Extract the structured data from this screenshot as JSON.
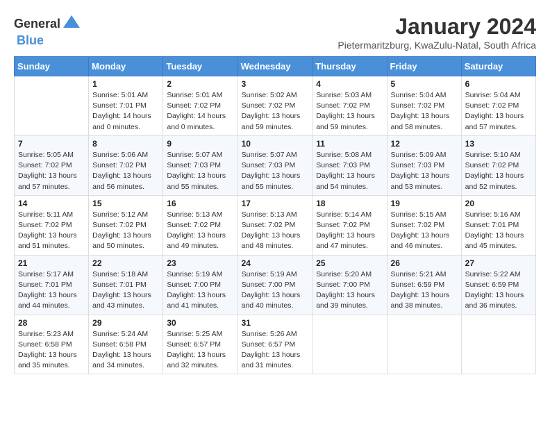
{
  "header": {
    "logo_general": "General",
    "logo_blue": "Blue",
    "month_title": "January 2024",
    "location": "Pietermaritzburg, KwaZulu-Natal, South Africa"
  },
  "days_of_week": [
    "Sunday",
    "Monday",
    "Tuesday",
    "Wednesday",
    "Thursday",
    "Friday",
    "Saturday"
  ],
  "weeks": [
    [
      {
        "day": "",
        "info": ""
      },
      {
        "day": "1",
        "info": "Sunrise: 5:01 AM\nSunset: 7:01 PM\nDaylight: 14 hours\nand 0 minutes."
      },
      {
        "day": "2",
        "info": "Sunrise: 5:01 AM\nSunset: 7:02 PM\nDaylight: 14 hours\nand 0 minutes."
      },
      {
        "day": "3",
        "info": "Sunrise: 5:02 AM\nSunset: 7:02 PM\nDaylight: 13 hours\nand 59 minutes."
      },
      {
        "day": "4",
        "info": "Sunrise: 5:03 AM\nSunset: 7:02 PM\nDaylight: 13 hours\nand 59 minutes."
      },
      {
        "day": "5",
        "info": "Sunrise: 5:04 AM\nSunset: 7:02 PM\nDaylight: 13 hours\nand 58 minutes."
      },
      {
        "day": "6",
        "info": "Sunrise: 5:04 AM\nSunset: 7:02 PM\nDaylight: 13 hours\nand 57 minutes."
      }
    ],
    [
      {
        "day": "7",
        "info": "Sunrise: 5:05 AM\nSunset: 7:02 PM\nDaylight: 13 hours\nand 57 minutes."
      },
      {
        "day": "8",
        "info": "Sunrise: 5:06 AM\nSunset: 7:02 PM\nDaylight: 13 hours\nand 56 minutes."
      },
      {
        "day": "9",
        "info": "Sunrise: 5:07 AM\nSunset: 7:03 PM\nDaylight: 13 hours\nand 55 minutes."
      },
      {
        "day": "10",
        "info": "Sunrise: 5:07 AM\nSunset: 7:03 PM\nDaylight: 13 hours\nand 55 minutes."
      },
      {
        "day": "11",
        "info": "Sunrise: 5:08 AM\nSunset: 7:03 PM\nDaylight: 13 hours\nand 54 minutes."
      },
      {
        "day": "12",
        "info": "Sunrise: 5:09 AM\nSunset: 7:03 PM\nDaylight: 13 hours\nand 53 minutes."
      },
      {
        "day": "13",
        "info": "Sunrise: 5:10 AM\nSunset: 7:02 PM\nDaylight: 13 hours\nand 52 minutes."
      }
    ],
    [
      {
        "day": "14",
        "info": "Sunrise: 5:11 AM\nSunset: 7:02 PM\nDaylight: 13 hours\nand 51 minutes."
      },
      {
        "day": "15",
        "info": "Sunrise: 5:12 AM\nSunset: 7:02 PM\nDaylight: 13 hours\nand 50 minutes."
      },
      {
        "day": "16",
        "info": "Sunrise: 5:13 AM\nSunset: 7:02 PM\nDaylight: 13 hours\nand 49 minutes."
      },
      {
        "day": "17",
        "info": "Sunrise: 5:13 AM\nSunset: 7:02 PM\nDaylight: 13 hours\nand 48 minutes."
      },
      {
        "day": "18",
        "info": "Sunrise: 5:14 AM\nSunset: 7:02 PM\nDaylight: 13 hours\nand 47 minutes."
      },
      {
        "day": "19",
        "info": "Sunrise: 5:15 AM\nSunset: 7:02 PM\nDaylight: 13 hours\nand 46 minutes."
      },
      {
        "day": "20",
        "info": "Sunrise: 5:16 AM\nSunset: 7:01 PM\nDaylight: 13 hours\nand 45 minutes."
      }
    ],
    [
      {
        "day": "21",
        "info": "Sunrise: 5:17 AM\nSunset: 7:01 PM\nDaylight: 13 hours\nand 44 minutes."
      },
      {
        "day": "22",
        "info": "Sunrise: 5:18 AM\nSunset: 7:01 PM\nDaylight: 13 hours\nand 43 minutes."
      },
      {
        "day": "23",
        "info": "Sunrise: 5:19 AM\nSunset: 7:00 PM\nDaylight: 13 hours\nand 41 minutes."
      },
      {
        "day": "24",
        "info": "Sunrise: 5:19 AM\nSunset: 7:00 PM\nDaylight: 13 hours\nand 40 minutes."
      },
      {
        "day": "25",
        "info": "Sunrise: 5:20 AM\nSunset: 7:00 PM\nDaylight: 13 hours\nand 39 minutes."
      },
      {
        "day": "26",
        "info": "Sunrise: 5:21 AM\nSunset: 6:59 PM\nDaylight: 13 hours\nand 38 minutes."
      },
      {
        "day": "27",
        "info": "Sunrise: 5:22 AM\nSunset: 6:59 PM\nDaylight: 13 hours\nand 36 minutes."
      }
    ],
    [
      {
        "day": "28",
        "info": "Sunrise: 5:23 AM\nSunset: 6:58 PM\nDaylight: 13 hours\nand 35 minutes."
      },
      {
        "day": "29",
        "info": "Sunrise: 5:24 AM\nSunset: 6:58 PM\nDaylight: 13 hours\nand 34 minutes."
      },
      {
        "day": "30",
        "info": "Sunrise: 5:25 AM\nSunset: 6:57 PM\nDaylight: 13 hours\nand 32 minutes."
      },
      {
        "day": "31",
        "info": "Sunrise: 5:26 AM\nSunset: 6:57 PM\nDaylight: 13 hours\nand 31 minutes."
      },
      {
        "day": "",
        "info": ""
      },
      {
        "day": "",
        "info": ""
      },
      {
        "day": "",
        "info": ""
      }
    ]
  ]
}
